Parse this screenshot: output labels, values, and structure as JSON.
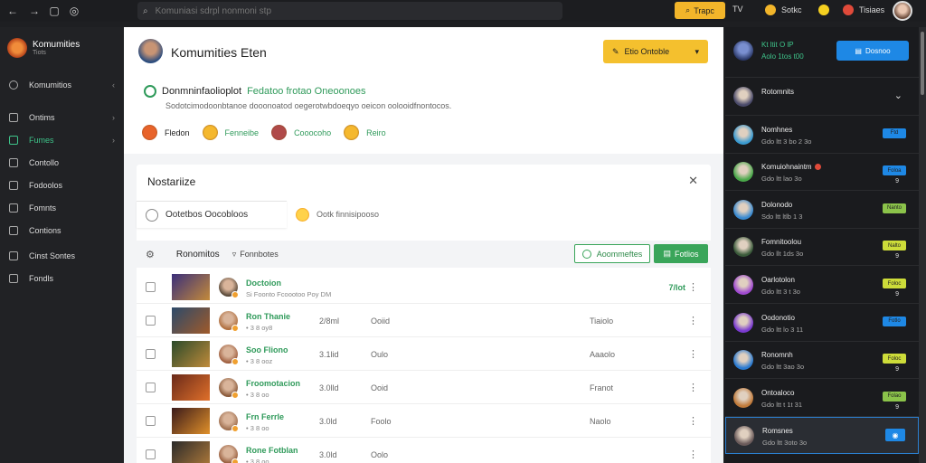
{
  "topbar": {
    "search_placeholder": "Komuniasi sdrpl nonmoni stp",
    "yellow_button": "Trapc",
    "item1": "TV",
    "item2": "Sotkc",
    "item3": "Tisiaes",
    "colors": {
      "yellow": "#f2b52a",
      "bg": "#1c1d20"
    }
  },
  "sidebar": {
    "brand_title": "Komumities",
    "brand_sub": "Tiots",
    "section": "Komumitios",
    "items": [
      {
        "label": "Ontims",
        "icon": "grid-icon",
        "active": false,
        "chevron": true
      },
      {
        "label": "Fumes",
        "icon": "folder-icon",
        "active": true,
        "chevron": true
      },
      {
        "label": "Contollo",
        "icon": "doc-icon",
        "active": false,
        "chevron": false
      },
      {
        "label": "Fodoolos",
        "icon": "chart-icon",
        "active": false,
        "chevron": false
      },
      {
        "label": "Fomnts",
        "icon": "list-icon",
        "active": false,
        "chevron": false
      },
      {
        "label": "Contions",
        "icon": "mail-icon",
        "active": false,
        "chevron": false
      },
      {
        "label": "Cinst Sontes",
        "icon": "gear-icon",
        "active": false,
        "chevron": false
      },
      {
        "label": "Fondls",
        "icon": "tag-icon",
        "active": false,
        "chevron": false
      }
    ]
  },
  "profile": {
    "name": "Komumities Eten",
    "action_button": "Etio Ontoble",
    "line1_main": "Donmninfaolioplot",
    "line1_green": "Fedatoo frotao Oneoonoes",
    "line2": "Sodotcimodoonbtanoe dooonoatod oegerotwbdoeqyo oeicon oolooidfnontocos.",
    "chips": [
      {
        "label": "Fledon",
        "green": false,
        "color": "#e8632a"
      },
      {
        "label": "Fenneibe",
        "green": true,
        "color": "#f5b82e"
      },
      {
        "label": "Cooocoho",
        "green": true,
        "color": "#b04a4a"
      },
      {
        "label": "Reiro",
        "green": true,
        "color": "#f5b82e"
      }
    ]
  },
  "panel": {
    "title": "Nostariize",
    "tab_active": "Ootetbos Oocobloos",
    "tab_other": "Ootk finnisipooso",
    "tools_label1": "Ronomitos",
    "tools_label2": "Fonnbotes",
    "btn_outline": "Aoommeftes",
    "btn_green": "Fotlios"
  },
  "rows": [
    {
      "name": "Doctoion",
      "sub": "Si Foonto Fcoootoo Poy DM",
      "c1": "",
      "c2": "",
      "c3": "",
      "value": "7/lot",
      "thumb": [
        "#3a2f7a",
        "#c48a3a"
      ],
      "ava": "#5a4a3a"
    },
    {
      "name": "Ron Thanie",
      "sub": "• 3 8 oy8",
      "c1": "2/8ml",
      "c2": "Ooiid",
      "c3": "Tiaiolo",
      "value": "",
      "thumb": [
        "#2c4a6a",
        "#a05a2a"
      ],
      "ava": "#b07040"
    },
    {
      "name": "Soo Fliono",
      "sub": "• 3 8 ooz",
      "c1": "3.1lid",
      "c2": "Oulo",
      "c3": "Aaaolo",
      "value": "",
      "thumb": [
        "#2a4a2a",
        "#c08a3a"
      ],
      "ava": "#a06040"
    },
    {
      "name": "Froomotacion",
      "sub": "• 3 8 oo",
      "c1": "3.0lld",
      "c2": "Ooid",
      "c3": "Franot",
      "value": "",
      "thumb": [
        "#6a2a1a",
        "#e0702a"
      ],
      "ava": "#8a5a3a"
    },
    {
      "name": "Frn Ferrle",
      "sub": "• 3 8 oo",
      "c1": "3.0ld",
      "c2": "Foolo",
      "c3": "Naolo",
      "value": "",
      "thumb": [
        "#3a1a1a",
        "#e0902a"
      ],
      "ava": "#a07050"
    },
    {
      "name": "Rone Fotblan",
      "sub": "• 3 8 oo",
      "c1": "3.0ld",
      "c2": "Oolo",
      "c3": "",
      "value": "",
      "thumb": [
        "#2a2a2a",
        "#b07a3a"
      ],
      "ava": "#9a6040"
    }
  ],
  "right": {
    "head_line1": "Kt ltit O lP",
    "head_line2": "Aolo 1tos t00",
    "head_button": "Dosnoo",
    "items": [
      {
        "name": "Rotomnits",
        "meta": "",
        "pill": "",
        "pill_color": "",
        "count": "",
        "chevron": true,
        "color": "#4a4a6a",
        "selected": false,
        "alert": false
      },
      {
        "name": "Nomhnes",
        "meta": "Gdo ltt 3 bo 2 3o",
        "pill": "Ftd",
        "pill_color": "#1e88e5",
        "count": "",
        "chevron": false,
        "color": "#3a9ad0",
        "selected": false,
        "alert": false
      },
      {
        "name": "Komuiohnaintm",
        "meta": "Gdo ltt lao 3o",
        "pill": "Foloa",
        "pill_color": "#1e88e5",
        "count": "9",
        "chevron": false,
        "color": "#4aa84a",
        "selected": false,
        "alert": true
      },
      {
        "name": "Dolonodo",
        "meta": "Sdo ltt ltlb  1 3",
        "pill": "Nanto",
        "pill_color": "#8bc34a",
        "count": "",
        "chevron": false,
        "color": "#3a8ad0",
        "selected": false,
        "alert": false
      },
      {
        "name": "Fomnitoolou",
        "meta": "Gdo llt  1ds 3o",
        "pill": "Nalto",
        "pill_color": "#cddc39",
        "count": "9",
        "chevron": false,
        "color": "#3a5a3a",
        "selected": false,
        "alert": false
      },
      {
        "name": "Oarlotolon",
        "meta": "Gdo ltt 3 t 3o",
        "pill": "Foloc",
        "pill_color": "#cddc39",
        "count": "9",
        "chevron": false,
        "color": "#a04ad0",
        "selected": false,
        "alert": false
      },
      {
        "name": "Oodonotio",
        "meta": "Gdo ltt lo 3 11",
        "pill": "Fotlo",
        "pill_color": "#1e88e5",
        "count": "",
        "chevron": false,
        "color": "#7a3ad0",
        "selected": false,
        "alert": false
      },
      {
        "name": "Ronomnh",
        "meta": "Gdo ltt 3ao 3o",
        "pill": "Foloc",
        "pill_color": "#cddc39",
        "count": "9",
        "chevron": false,
        "color": "#2a7ad0",
        "selected": false,
        "alert": false
      },
      {
        "name": "Ontoaloco",
        "meta": "Gdo ltt t 1t 31",
        "pill": "Folao",
        "pill_color": "#8bc34a",
        "count": "9",
        "chevron": false,
        "color": "#c07a3a",
        "selected": false,
        "alert": false
      },
      {
        "name": "Romsnes",
        "meta": "Gdo ltt 3oto 3o",
        "pill": "",
        "pill_color": "",
        "count": "",
        "chevron": false,
        "color": "#6a5a5a",
        "selected": true,
        "alert": false
      }
    ]
  }
}
